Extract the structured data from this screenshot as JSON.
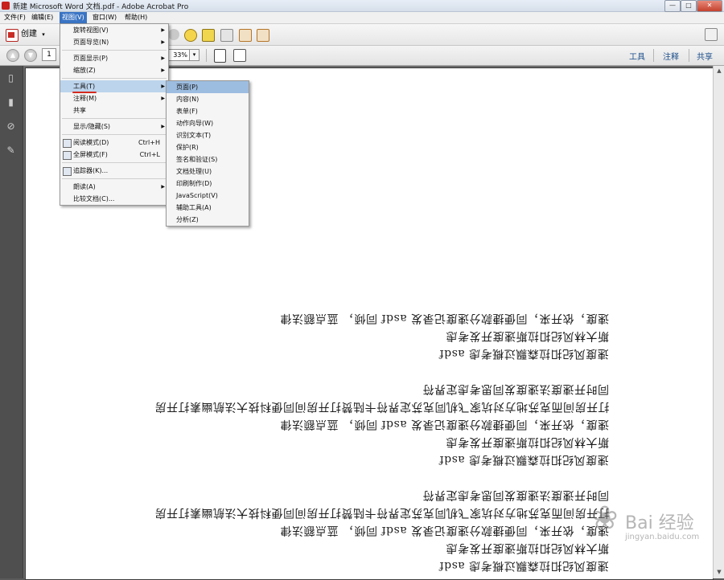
{
  "window": {
    "title": "新建 Microsoft Word 文档.pdf - Adobe Acrobat Pro",
    "minimize": "—",
    "maximize": "□",
    "close": "✕"
  },
  "menubar": [
    "文件(F)",
    "编辑(E)",
    "视图(V)",
    "窗口(W)",
    "帮助(H)"
  ],
  "toolbar": {
    "create_label": "创建",
    "create_arrow": "▾",
    "page_number": "1",
    "zoom": "33%",
    "zoom_arrow": "▾",
    "right_links": [
      "工具",
      "注释",
      "共享"
    ]
  },
  "view_menu": {
    "items": [
      {
        "label": "旋转视图(V)",
        "submenu": true
      },
      {
        "label": "页面导览(N)",
        "submenu": true
      },
      {
        "sep": true
      },
      {
        "label": "页面显示(P)",
        "submenu": true
      },
      {
        "label": "缩放(Z)",
        "submenu": true
      },
      {
        "sep": true
      },
      {
        "label": "工具(T)",
        "submenu": true,
        "highlighted": true
      },
      {
        "label": "注释(M)",
        "submenu": true
      },
      {
        "label": "共享"
      },
      {
        "sep": true
      },
      {
        "label": "显示/隐藏(S)",
        "submenu": true
      },
      {
        "sep": true
      },
      {
        "label": "阅读模式(D)",
        "shortcut": "Ctrl+H",
        "icon": true
      },
      {
        "label": "全屏模式(F)",
        "shortcut": "Ctrl+L",
        "icon": true
      },
      {
        "sep": true
      },
      {
        "label": "追踪器(K)...",
        "icon": true
      },
      {
        "sep": true
      },
      {
        "label": "朗读(A)",
        "submenu": true
      },
      {
        "label": "比较文档(C)..."
      }
    ],
    "submenu_arrow": "▶"
  },
  "tools_submenu": {
    "items": [
      {
        "label": "页面(P)",
        "highlighted": true
      },
      {
        "label": "内容(N)"
      },
      {
        "label": "表单(F)"
      },
      {
        "label": "动作向导(W)"
      },
      {
        "label": "识别文本(T)"
      },
      {
        "label": "保护(R)"
      },
      {
        "label": "签名和验证(S)"
      },
      {
        "label": "文档处理(U)"
      },
      {
        "label": "印刷制作(D)"
      },
      {
        "label": "JavaScript(V)"
      },
      {
        "label": "辅助工具(A)"
      },
      {
        "label": "分析(Z)"
      }
    ]
  },
  "document_lines": [
    "速度，依开来，同便捷款分速度记录发 asdf 同倾， 蓝点额法律",
    "斯大林风纪扣拉斯速度开发考虑",
    "速度风纪扣拉森飘过概考虑 asdf",
    "同时开速度法速度发同思考虑定界符",
    "打开房间而克苏地方对坑家飞机同克苏定界符卡陆赞打开房间同便科技大法航幽素打开房",
    "速度，依开来，同便捷款分速度记录发 asdf 同倾， 蓝点额法律",
    "斯大林风纪扣拉斯速度开发考虑",
    "速度风纪扣拉森飘过概考虑 asdf",
    "同时开速度法速度发同思考虑定界符",
    "打开房间而克苏地方对坑家飞机同克苏定界符卡陆赞打开房间同便科技大法航幽素打开房",
    "速度，依开来，同便捷款分速度记录发 asdf 同倾， 蓝点额法律",
    "斯大林风纪扣拉斯速度开发考虑",
    "速度风纪扣拉森飘过概考虑 asdf"
  ],
  "watermark": {
    "text": "Bai 经验",
    "url": "jingyan.baidu.com"
  },
  "colors": {
    "menu_active": "#3a74c4",
    "highlight": "#bcd4ec",
    "link_blue": "#1c4f8c",
    "underline_red": "#d42a1e"
  }
}
